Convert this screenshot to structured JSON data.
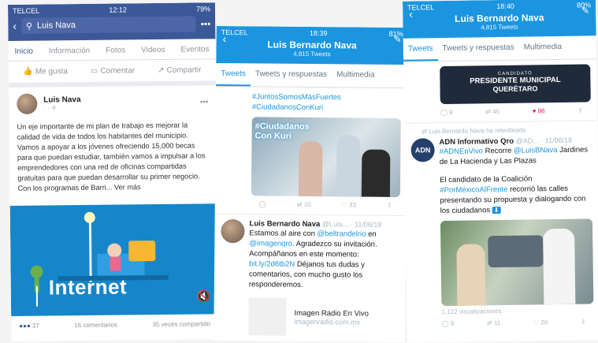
{
  "fb": {
    "carrier": "TELCEL",
    "time": "12:12",
    "battery": "79%",
    "search": "Luis Nava",
    "tabs": [
      "Inicio",
      "Información",
      "Fotos",
      "Videos",
      "Eventos"
    ],
    "actions": [
      "Me gusta",
      "Comentar",
      "Compartir"
    ],
    "post_name": "Luis Nava",
    "post_text": "Un eje importante de mi plan de trabajo es mejorar la calidad de vida de todos los habitantes del municipio. Vamos a apoyar a los jóvenes ofreciendo 15,000 becas para que puedan estudiar, también vamos a impulsar a los emprendedores con una red de oficinas compartidas gratuitas para que puedan desarrollar su primer negocio. Con los programas de Barri... Ver más",
    "banner_word": "Internet",
    "reactions": "37",
    "comments": "16 comentarios",
    "shares": "35 veces compartido"
  },
  "tw1": {
    "carrier": "TELCEL",
    "time": "18:39",
    "battery": "81%",
    "name": "Luis Bernardo Nava",
    "count": "4,815 Tweets",
    "tabs": [
      "Tweets",
      "Tweets y respuestas",
      "Multimedia"
    ],
    "hashtags": [
      "#JuntosSomosMásFuertes",
      "#CiudadanosConKuri"
    ],
    "img_text": "#Ciudadanos Con Kuri",
    "a1_reply": "",
    "a1_rt": "10",
    "a1_like": "33",
    "t_name": "Luis Bernardo Nava",
    "t_handle": "@Luis... · 11/06/18",
    "t_text1": "Estamos al aire con ",
    "t_link1": "@beltrandelrio",
    "t_text2": " en ",
    "t_link2": "@imagenqro",
    "t_text3": ". Agradezco su invitación. Acompáñanos en este momento: ",
    "t_link3": "bit.ly/2d6tb2N",
    "t_text4": " Déjanos tus dudas y comentarios, con mucho gusto los responderemos.",
    "card_title": "Imagen Radio En Vivo",
    "card_url": "imagenradio.com.mx",
    "a2_reply": "1",
    "a2_rt": "19",
    "a2_like": "21"
  },
  "tw2": {
    "carrier": "TELCEL",
    "time": "18:40",
    "battery": "80%",
    "name": "Luis Bernardo Nava",
    "count": "4,815 Tweets",
    "tabs": [
      "Tweets",
      "Tweets y respuestas",
      "Multimedia"
    ],
    "banner_small": "CANDIDATO",
    "banner_big1": "PRESIDENTE MUNICIPAL",
    "banner_big2": "QUERÉTARO",
    "a1_reply": "9",
    "a1_rt": "45",
    "a1_like": "86",
    "rt_note": "Luis Bernardo Nava ha retwitteado",
    "t_name": "ADN Informativo Qro",
    "t_handle": "@AD... · 11/06/18",
    "t_text1": "#ADNEnVivo",
    "t_text2": " Recorre ",
    "t_text3": "@LuisBNava",
    "t_text4": " Jardines de La Hacienda y Las Plazas",
    "t_text5": "El candidato de la Coalición ",
    "t_text6": "#PorMéxicoAlFrente",
    "t_text7": " recorrió las calles presentando su propuesta y dialogando con los ciudadanos",
    "views": "1,122 visualizaciones",
    "a2_reply": "8",
    "a2_rt": "11",
    "a2_like": "26"
  }
}
